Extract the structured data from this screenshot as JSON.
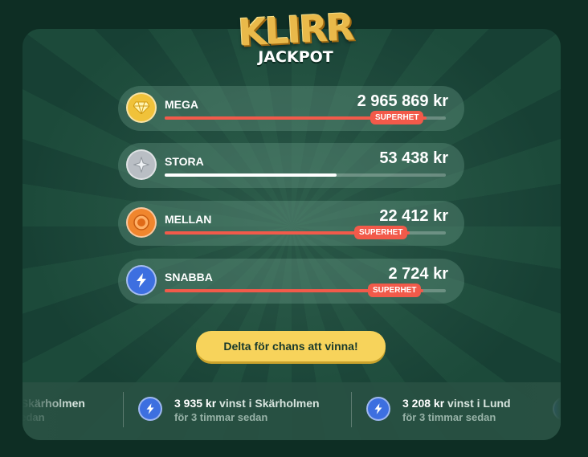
{
  "logo": {
    "main": "KLIRR",
    "sub": "JACKPOT"
  },
  "tiers": [
    {
      "name": "MEGA",
      "amount": "2 965 869 kr",
      "icon": "diamond-icon",
      "progress": 0.93,
      "badge": "SUPERHET",
      "bar_color": "#f25a4a",
      "icon_color": "#f0c23a"
    },
    {
      "name": "STORA",
      "amount": "53 438 kr",
      "icon": "star-icon",
      "progress": 0.61,
      "badge": "",
      "bar_color": "#ffffff",
      "icon_color": "#b9bec4"
    },
    {
      "name": "MELLAN",
      "amount": "22 412 kr",
      "icon": "circle-icon",
      "progress": 0.87,
      "badge": "SUPERHET",
      "bar_color": "#f25a4a",
      "icon_color": "#f0862e"
    },
    {
      "name": "SNABBA",
      "amount": "2 724 kr",
      "icon": "lightning-icon",
      "progress": 0.92,
      "badge": "SUPERHET",
      "bar_color": "#f25a4a",
      "icon_color": "#3d6fe0"
    }
  ],
  "cta": {
    "label": "Delta för chans att vinna!"
  },
  "ticker": [
    {
      "amount": "",
      "text": "i Skärholmen",
      "time": "sedan"
    },
    {
      "amount": "3 935 kr",
      "text": " vinst i Skärholmen",
      "time": "för 3 timmar sedan"
    },
    {
      "amount": "3 208 kr",
      "text": " vinst i Lund",
      "time": "för 3 timmar sedan"
    }
  ]
}
